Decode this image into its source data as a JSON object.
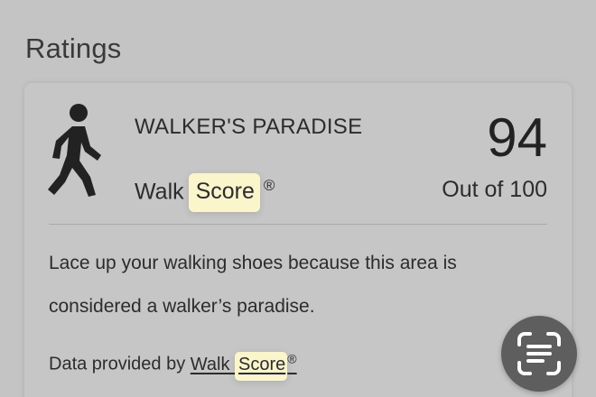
{
  "section": {
    "title": "Ratings"
  },
  "rating": {
    "label": "WALKER'S PARADISE",
    "brand_prefix": "Walk ",
    "brand_highlight": "Score",
    "reg_mark": "®",
    "score": "94",
    "score_max": "Out of 100",
    "description": "Lace up your walking shoes because this area is considered a walker’s paradise."
  },
  "provider": {
    "prefix": "Data provided by ",
    "link_prefix": "Walk ",
    "link_highlight": "Score",
    "reg_mark": "®"
  },
  "icons": {
    "walker": "pedestrian-icon",
    "scan": "text-scan-icon"
  },
  "colors": {
    "background": "#c4c4c4",
    "highlight": "#fbf5cc",
    "scan_button": "#5e5e5e"
  }
}
